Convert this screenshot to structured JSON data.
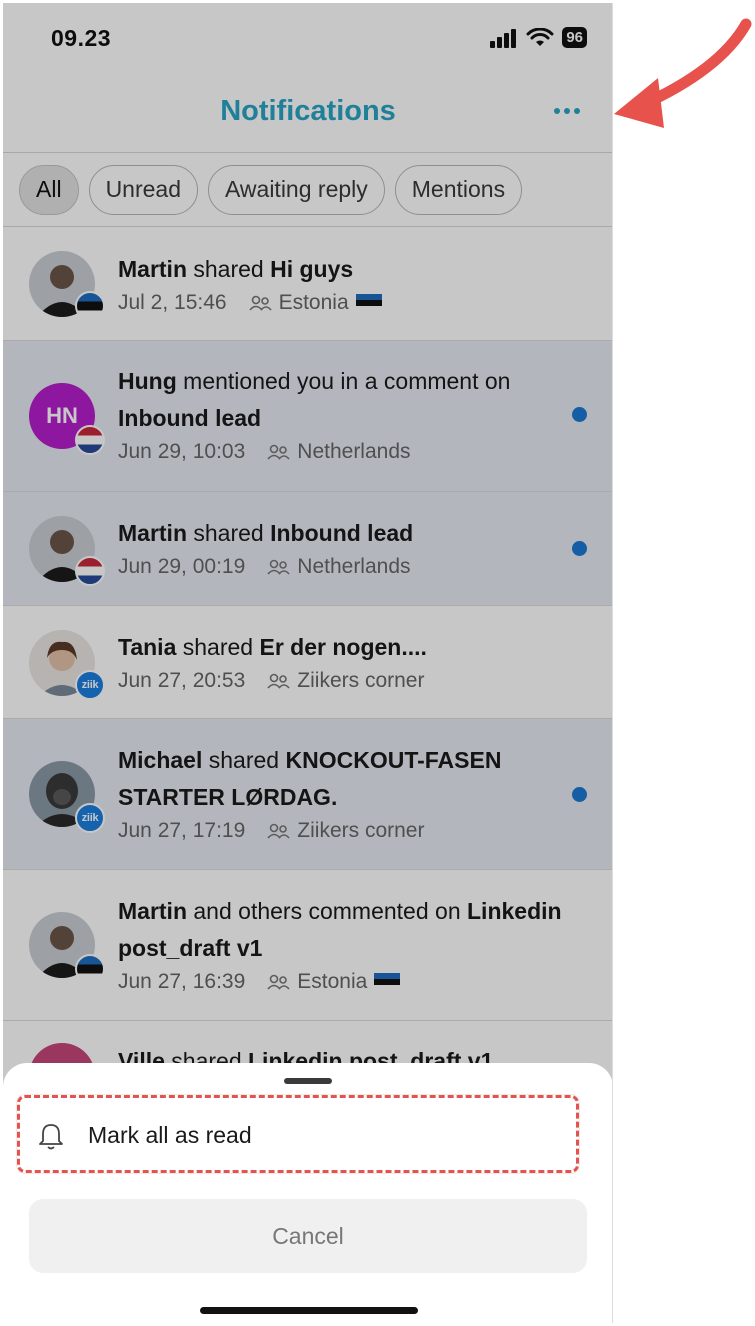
{
  "status_bar": {
    "time": "09.23",
    "battery": "96"
  },
  "header": {
    "title": "Notifications",
    "more_icon": "more-dots-icon"
  },
  "tabs": [
    {
      "label": "All",
      "active": true
    },
    {
      "label": "Unread",
      "active": false
    },
    {
      "label": "Awaiting reply",
      "active": false
    },
    {
      "label": "Mentions",
      "active": false
    }
  ],
  "notifications": [
    {
      "actor": "Martin",
      "action": " shared ",
      "subject": "Hi guys",
      "time": "Jul 2, 15:46",
      "group": "Estonia",
      "group_flag": "estonia-flag-icon",
      "unread": false,
      "avatar": "photo",
      "badge": "estonia-flag-icon"
    },
    {
      "actor": "Hung",
      "action": " mentioned you in a comment on ",
      "subject": "Inbound lead",
      "time": "Jun 29, 10:03",
      "group": "Netherlands",
      "unread": true,
      "avatar": "initials",
      "avatar_initials": "HN",
      "avatar_color": "#b51fcc",
      "badge": "netherlands-flag-icon"
    },
    {
      "actor": "Martin",
      "action": " shared ",
      "subject": "Inbound lead",
      "time": "Jun 29, 00:19",
      "group": "Netherlands",
      "unread": true,
      "avatar": "photo",
      "badge": "netherlands-flag-icon"
    },
    {
      "actor": "Tania",
      "action": " shared ",
      "subject": "Er der nogen....",
      "time": "Jun 27, 20:53",
      "group": "Ziikers corner",
      "unread": false,
      "avatar": "photo",
      "badge": "ziik"
    },
    {
      "actor": "Michael",
      "action": " shared ",
      "subject": "KNOCKOUT-FASEN STARTER LØRDAG.",
      "time": "Jun 27, 17:19",
      "group": "Ziikers corner",
      "unread": true,
      "avatar": "photo",
      "badge": "ziik"
    },
    {
      "actor": "Martin",
      "action": " and others commented on ",
      "subject": "Linkedin post_draft v1",
      "time": "Jun 27, 16:39",
      "group": "Estonia",
      "group_flag": "estonia-flag-icon",
      "unread": false,
      "avatar": "photo",
      "badge": "estonia-flag-icon"
    },
    {
      "actor": "Ville",
      "action": " shared ",
      "subject": "Linkedin post_draft v1",
      "unread": false,
      "avatar": "photo"
    }
  ],
  "ziik_badge_text": "ziik",
  "sheet": {
    "mark_all_read_label": "Mark all as read",
    "mark_all_read_icon": "bell-icon",
    "cancel_label": "Cancel"
  },
  "annotation": {
    "arrow_color": "#e8524c",
    "highlight_color": "#e05550"
  }
}
